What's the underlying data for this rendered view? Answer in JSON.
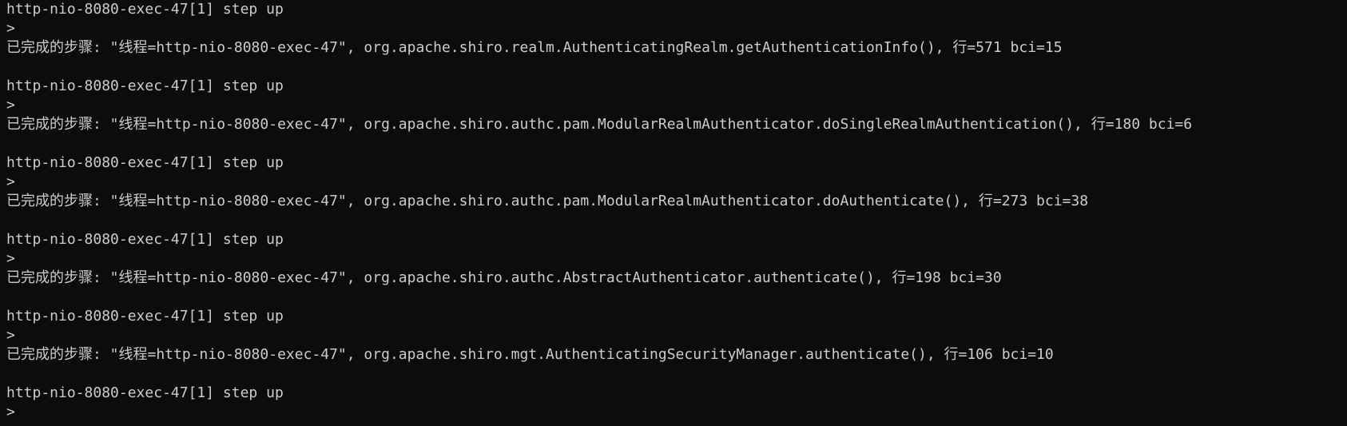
{
  "terminal": {
    "lines": [
      {
        "kind": "command",
        "text": "http-nio-8080-exec-47[1] step up"
      },
      {
        "kind": "prompt",
        "text": ">"
      },
      {
        "kind": "output",
        "text": "已完成的步骤: \"线程=http-nio-8080-exec-47\", org.apache.shiro.realm.AuthenticatingRealm.getAuthenticationInfo(), 行=571 bci=15"
      },
      {
        "kind": "blank",
        "text": ""
      },
      {
        "kind": "command",
        "text": "http-nio-8080-exec-47[1] step up"
      },
      {
        "kind": "prompt",
        "text": ">"
      },
      {
        "kind": "output",
        "text": "已完成的步骤: \"线程=http-nio-8080-exec-47\", org.apache.shiro.authc.pam.ModularRealmAuthenticator.doSingleRealmAuthentication(), 行=180 bci=6"
      },
      {
        "kind": "blank",
        "text": ""
      },
      {
        "kind": "command",
        "text": "http-nio-8080-exec-47[1] step up"
      },
      {
        "kind": "prompt",
        "text": ">"
      },
      {
        "kind": "output",
        "text": "已完成的步骤: \"线程=http-nio-8080-exec-47\", org.apache.shiro.authc.pam.ModularRealmAuthenticator.doAuthenticate(), 行=273 bci=38"
      },
      {
        "kind": "blank",
        "text": ""
      },
      {
        "kind": "command",
        "text": "http-nio-8080-exec-47[1] step up"
      },
      {
        "kind": "prompt",
        "text": ">"
      },
      {
        "kind": "output",
        "text": "已完成的步骤: \"线程=http-nio-8080-exec-47\", org.apache.shiro.authc.AbstractAuthenticator.authenticate(), 行=198 bci=30"
      },
      {
        "kind": "blank",
        "text": ""
      },
      {
        "kind": "command",
        "text": "http-nio-8080-exec-47[1] step up"
      },
      {
        "kind": "prompt",
        "text": ">"
      },
      {
        "kind": "output",
        "text": "已完成的步骤: \"线程=http-nio-8080-exec-47\", org.apache.shiro.mgt.AuthenticatingSecurityManager.authenticate(), 行=106 bci=10"
      },
      {
        "kind": "blank",
        "text": ""
      },
      {
        "kind": "command",
        "text": "http-nio-8080-exec-47[1] step up"
      },
      {
        "kind": "prompt",
        "text": ">"
      }
    ],
    "colors": {
      "background": "#0c0c0c",
      "foreground": "#cccccc"
    }
  }
}
